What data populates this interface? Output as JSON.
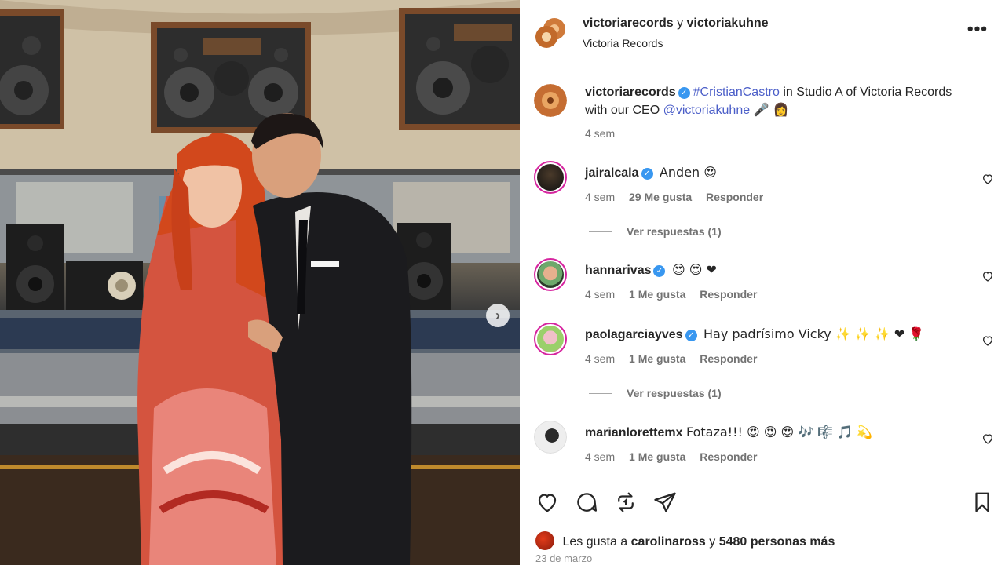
{
  "post": {
    "authors": {
      "first": "victoriarecords",
      "conjunction": "y",
      "second": "victoriakuhne"
    },
    "location": "Victoria Records",
    "more_icon": "more-horizontal-icon"
  },
  "caption": {
    "user": "victoriarecords",
    "hashtag": "#CristianCastro",
    "text_1": " in Studio A of Victoria Records with our CEO ",
    "mention": "@victoriakuhne",
    "emojis": "🎤 👩",
    "time": "4 sem"
  },
  "comments": [
    {
      "user": "jairalcala",
      "verified": true,
      "text": "Anden 😍",
      "time": "4 sem",
      "likes": "29 Me gusta",
      "reply": "Responder",
      "view_replies": "Ver respuestas (1)"
    },
    {
      "user": "hannarivas",
      "verified": true,
      "text": "😍 😍 ❤",
      "time": "4 sem",
      "likes": "1 Me gusta",
      "reply": "Responder"
    },
    {
      "user": "paolagarciayves",
      "verified": true,
      "text": "Hay padrísimo Vicky ✨ ✨ ✨ ❤ 🌹",
      "time": "4 sem",
      "likes": "1 Me gusta",
      "reply": "Responder",
      "view_replies": "Ver respuestas (1)"
    },
    {
      "user": "marianlorettemx",
      "verified": false,
      "text": "Fotaza!!! 😍 😍 😍 🎶 🎼 🎵 💫",
      "time": "4 sem",
      "likes": "1 Me gusta",
      "reply": "Responder"
    }
  ],
  "footer": {
    "likes_prefix": "Les gusta a",
    "likes_user": "carolinaross",
    "likes_conj": "y",
    "likes_count": "5480 personas más",
    "date": "23 de marzo"
  },
  "icons": {
    "like": "heart-icon",
    "comment": "comment-icon",
    "share": "repost-icon",
    "send": "send-icon",
    "save": "bookmark-icon",
    "next": "chevron-right-icon"
  },
  "next_glyph": "›"
}
